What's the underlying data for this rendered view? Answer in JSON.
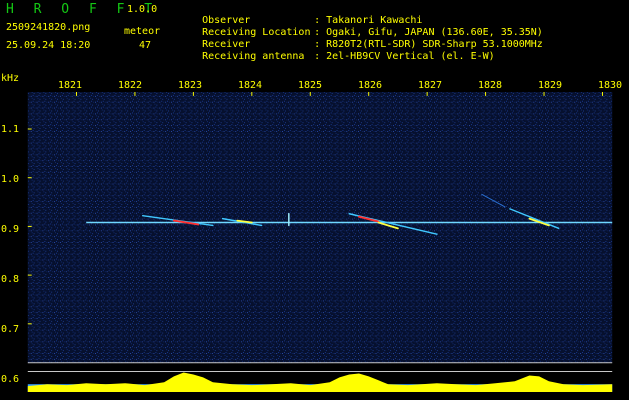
{
  "header": {
    "app_name": "H R O F F T",
    "version": "1.0.0",
    "filename": "2509241820.png",
    "datetime": "25.09.24 18:20",
    "meteor_label": "meteor",
    "meteor_count": "47",
    "rows": [
      {
        "label": "Observer",
        "sep": ":",
        "value": "Takanori Kawachi"
      },
      {
        "label": "Receiving Location",
        "sep": ":",
        "value": "Ogaki, Gifu, JAPAN (136.60E, 35.35N)"
      },
      {
        "label": "Receiver",
        "sep": ":",
        "value": "R820T2(RTL-SDR) SDR-Sharp 53.1000MHz"
      },
      {
        "label": "Receiving antenna",
        "sep": ":",
        "value": "2el-HB9CV Vertical (el. E-W)"
      }
    ]
  },
  "waterfall": {
    "y_unit": "kHz",
    "x_ticks": [
      "1821",
      "1822",
      "1823",
      "1824",
      "1825",
      "1826",
      "1827",
      "1828",
      "1829",
      "1830"
    ],
    "y_ticks": [
      "1.1",
      "1.0",
      "0.9",
      "0.8",
      "0.7",
      "0.6"
    ],
    "colors": {
      "background": "#000000",
      "axis_text": "#ffff00",
      "title": "#14c814",
      "noise": "#0a1a4a",
      "signal": "#4ad0ff",
      "meteor_hot": "#ff3030",
      "power": "#ffff00",
      "power_base": "#3aa0ff"
    }
  }
}
